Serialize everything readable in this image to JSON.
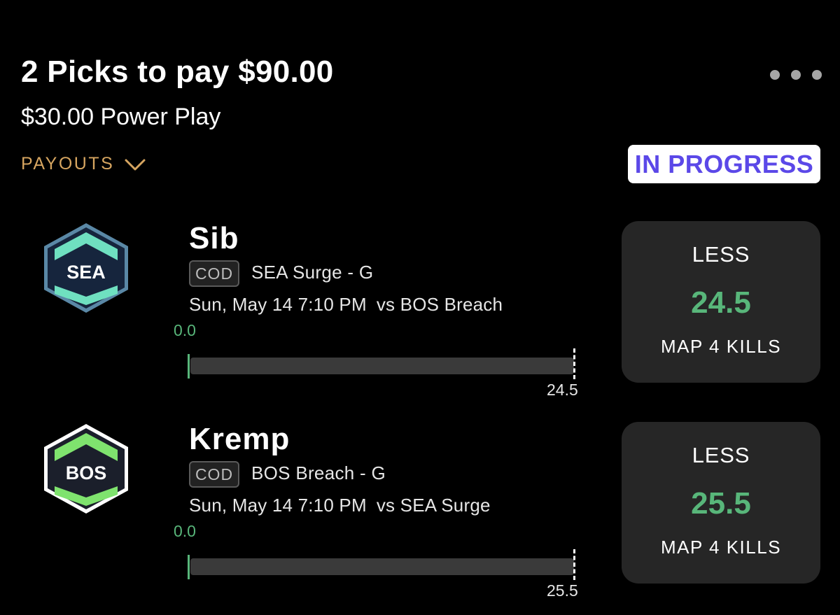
{
  "header": {
    "title": "2 Picks to pay $90.00",
    "subtitle": "$30.00 Power Play",
    "payouts_label": "PAYOUTS",
    "status": "IN PROGRESS",
    "more_icon": "more-horizontal-icon"
  },
  "colors": {
    "background": "#000000",
    "accent_gold": "#d6a560",
    "status_text": "#5b48e8",
    "positive_green": "#58b67a",
    "card_bg": "#262626"
  },
  "picks": [
    {
      "team_logo_text": "SEA",
      "logo_icon": "sea-surge-logo",
      "player": "Sib",
      "league": "COD",
      "team": "SEA Surge - G",
      "datetime": "Sun, May 14 7:10 PM",
      "opponent": "vs BOS Breach",
      "current": "0.0",
      "target": "24.5",
      "progress_fraction": 0,
      "direction": "LESS",
      "line": "24.5",
      "stat": "MAP 4 KILLS"
    },
    {
      "team_logo_text": "BOS",
      "logo_icon": "bos-breach-logo",
      "player": "Kremp",
      "league": "COD",
      "team": "BOS Breach - G",
      "datetime": "Sun, May 14 7:10 PM",
      "opponent": "vs SEA Surge",
      "current": "0.0",
      "target": "25.5",
      "progress_fraction": 0,
      "direction": "LESS",
      "line": "25.5",
      "stat": "MAP 4 KILLS"
    }
  ]
}
